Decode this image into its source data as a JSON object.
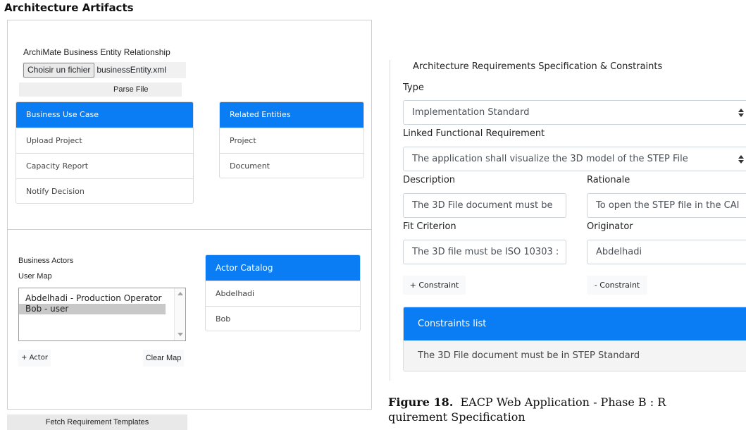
{
  "page_title": "Architecture Artifacts",
  "left": {
    "entity_label": "ArchiMate Business Entity Relationship",
    "file_button": "Choisir un fichier",
    "file_name": "businessEntity.xml",
    "parse_button": "Parse File",
    "use_cases": {
      "header": "Business Use Case",
      "items": [
        "Upload Project",
        "Capacity Report",
        "Notify Decision"
      ]
    },
    "related": {
      "header": "Related Entities",
      "items": [
        "Project",
        "Document"
      ]
    },
    "actors_label": "Business Actors",
    "user_map_label": "User Map",
    "user_map_options": [
      "Abdelhadi - Production Operator",
      "Bob - user"
    ],
    "actor_catalog": {
      "header": "Actor Catalog",
      "items": [
        "Abdelhadi",
        "Bob"
      ]
    },
    "add_actor_button": "+ Actor",
    "clear_map_button": "Clear Map",
    "fetch_button": "Fetch Requirement Templates"
  },
  "right": {
    "section_title": "Architecture Requirements Specification & Constraints",
    "type_label": "Type",
    "type_value": "Implementation Standard",
    "linked_label": "Linked Functional Requirement",
    "linked_value": "The application shall visualize the 3D model of the STEP File",
    "description_label": "Description",
    "description_value": "The 3D File document must be",
    "rationale_label": "Rationale",
    "rationale_value": "To open the STEP file in the CAI",
    "fit_label": "Fit Criterion",
    "fit_value": "The 3D file must be ISO 10303 :",
    "originator_label": "Originator",
    "originator_value": "Abdelhadi",
    "add_constraint": "+ Constraint",
    "remove_constraint": "- Constraint",
    "constraints_header": "Constraints list",
    "constraints": [
      "The 3D File document must be in STEP Standard"
    ]
  },
  "caption": {
    "label": "Figure 18.",
    "text_line1": "EACP Web Application - Phase B : R",
    "text_line2": "quirement Specification"
  },
  "colors": {
    "accent": "#0a7cf4"
  }
}
